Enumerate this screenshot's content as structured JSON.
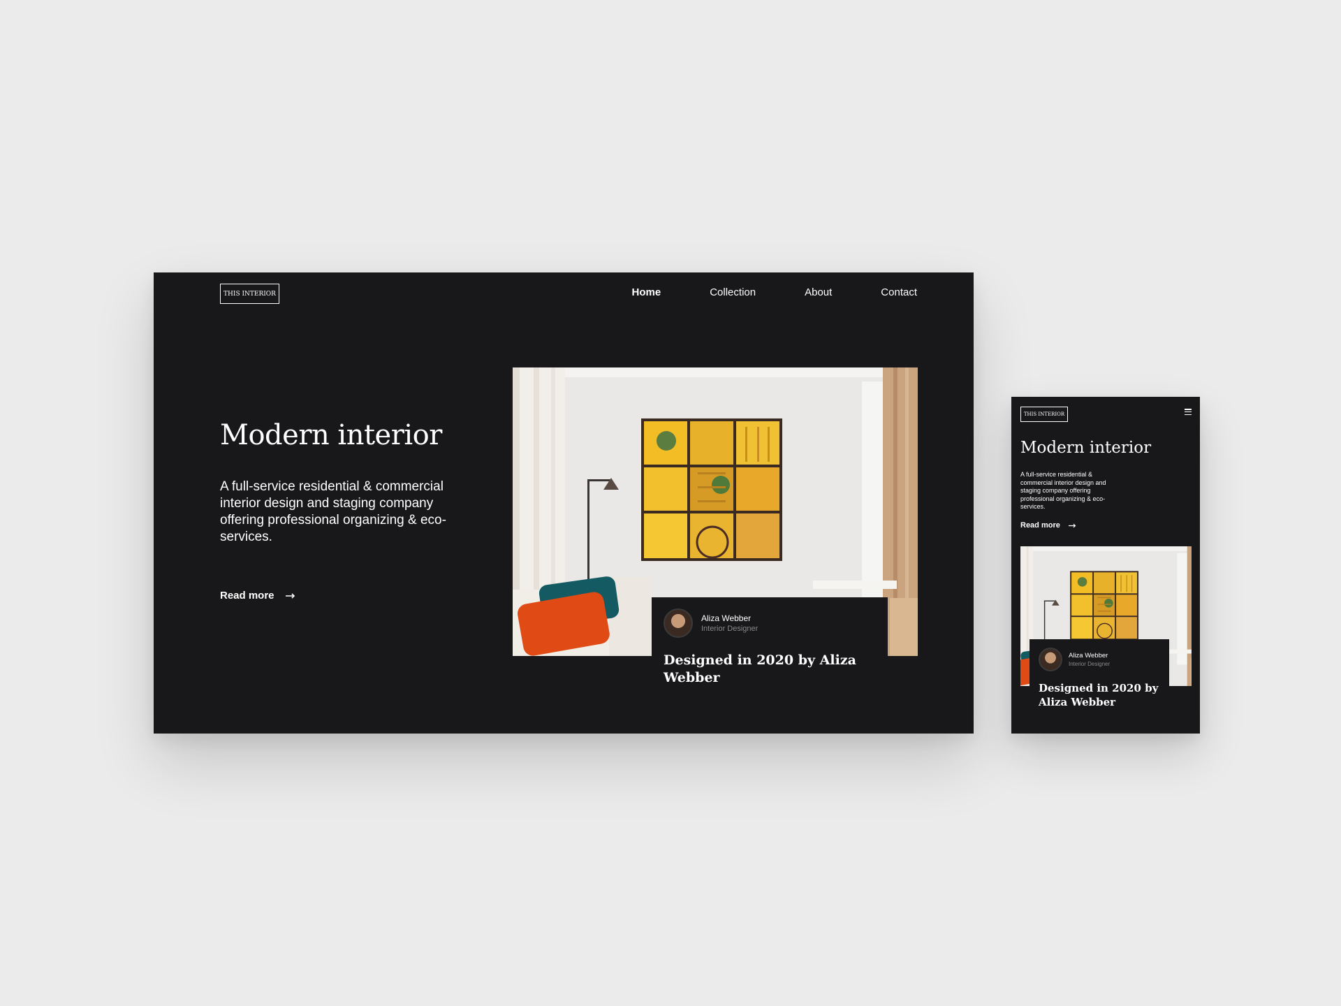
{
  "brand": {
    "logo_text": "THIS INTERIOR"
  },
  "nav": {
    "items": [
      {
        "label": "Home"
      },
      {
        "label": "Collection"
      },
      {
        "label": "About"
      },
      {
        "label": "Contact"
      }
    ],
    "active": "Home"
  },
  "hero": {
    "title": "Modern interior",
    "description": "A full-service residential & commercial interior design and staging company offering professional organizing & eco-services.",
    "cta_label": "Read more",
    "cta_icon": "arrow-right-icon"
  },
  "feature": {
    "image": "living-room-with-yellow-art-photo",
    "author_name": "Aliza Webber",
    "author_role": "Interior Designer",
    "title": "Designed in 2020 by Aliza Webber"
  },
  "mobile": {
    "menu_icon": "hamburger-menu-icon"
  },
  "colors": {
    "page_background": "#ebebeb",
    "panel_background": "#18181b",
    "text": "#ffffff",
    "muted_text": "#8a8a8a"
  }
}
